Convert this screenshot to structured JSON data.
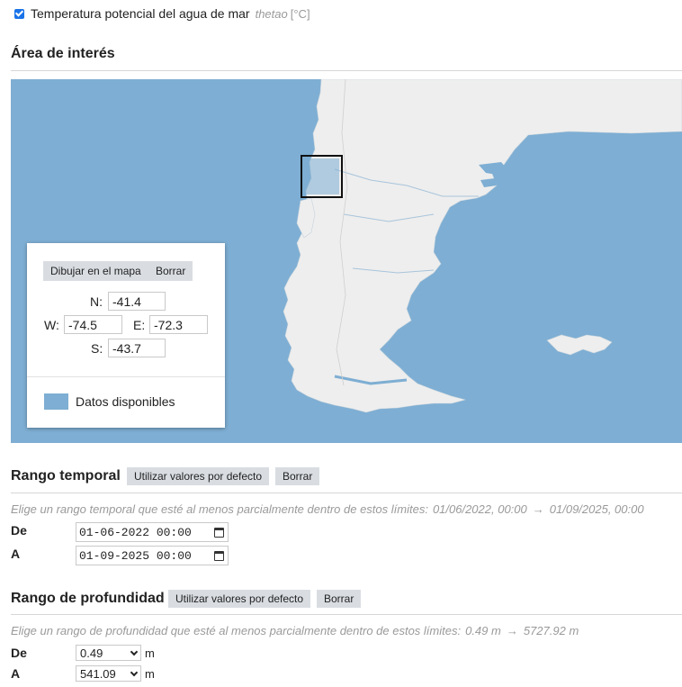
{
  "variable": {
    "checked": true,
    "name": "Temperatura potencial del agua de mar",
    "code": "thetao",
    "unit": "[°C]"
  },
  "area": {
    "title": "Área de interés",
    "draw_button": "Dibujar en el mapa",
    "clear_button": "Borrar",
    "north_label": "N:",
    "north_value": "-41.4",
    "west_label": "W:",
    "west_value": "-74.5",
    "east_label": "E:",
    "east_value": "-72.3",
    "south_label": "S:",
    "south_value": "-43.7",
    "legend_label": "Datos disponibles"
  },
  "time": {
    "title": "Rango temporal",
    "default_button": "Utilizar valores por defecto",
    "clear_button": "Borrar",
    "hint": "Elige un rango temporal que esté al menos parcialmente dentro de estos límites:",
    "min": "01/06/2022, 00:00",
    "arrow": "→",
    "max": "01/09/2025, 00:00",
    "from_label": "De",
    "from_value": "01-06-2022 00:00",
    "to_label": "A",
    "to_value": "01-09-2025 00:00"
  },
  "depth": {
    "title": "Rango de profundidad",
    "default_button": "Utilizar valores por defecto",
    "clear_button": "Borrar",
    "hint": "Elige un rango de profundidad que esté al menos parcialmente dentro de estos límites:",
    "min": "0.49 m",
    "arrow": "→",
    "max": "5727.92 m",
    "from_label": "De",
    "from_value": "0.49",
    "from_unit": "m",
    "to_label": "A",
    "to_value": "541.09",
    "to_unit": "m"
  },
  "colors": {
    "ocean": "#7eaed3",
    "land": "#eeeeee",
    "button": "#d9dde2"
  }
}
